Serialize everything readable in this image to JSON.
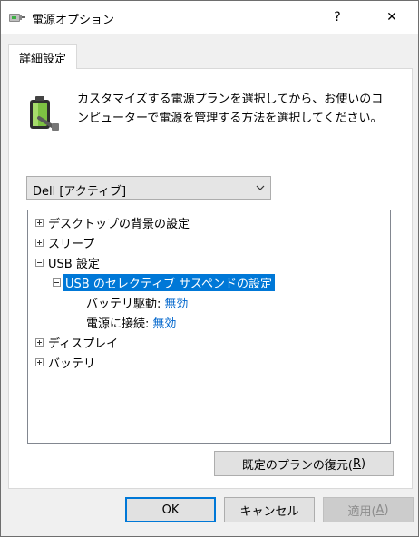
{
  "window": {
    "title": "電源オプション",
    "help_glyph": "?",
    "close_glyph": "✕"
  },
  "tab": {
    "label": "詳細設定"
  },
  "description": "カスタマイズする電源プランを選択してから、お使いのコンピューターで電源を管理する方法を選択してください。",
  "plan_select": {
    "value": "Dell [アクティブ]"
  },
  "tree": {
    "desktop_background": "デスクトップの背景の設定",
    "sleep": "スリープ",
    "usb": "USB 設定",
    "usb_selective": "USB のセレクティブ サスペンドの設定",
    "on_battery_label": "バッテリ駆動:",
    "on_battery_value": "無効",
    "plugged_in_label": "電源に接続:",
    "plugged_in_value": "無効",
    "display": "ディスプレイ",
    "battery": "バッテリ"
  },
  "buttons": {
    "restore_label": "既定のプランの復元(",
    "restore_mnemonic": "R",
    "restore_suffix": ")",
    "ok": "OK",
    "cancel": "キャンセル",
    "apply_label": "適用(",
    "apply_mnemonic": "A",
    "apply_suffix": ")"
  },
  "colors": {
    "accent": "#0078d7",
    "link": "#0066cc"
  },
  "icons": {
    "title": "power-plug-icon",
    "panel": "battery-plug-icon",
    "dropdown": "chevron-down-icon"
  }
}
